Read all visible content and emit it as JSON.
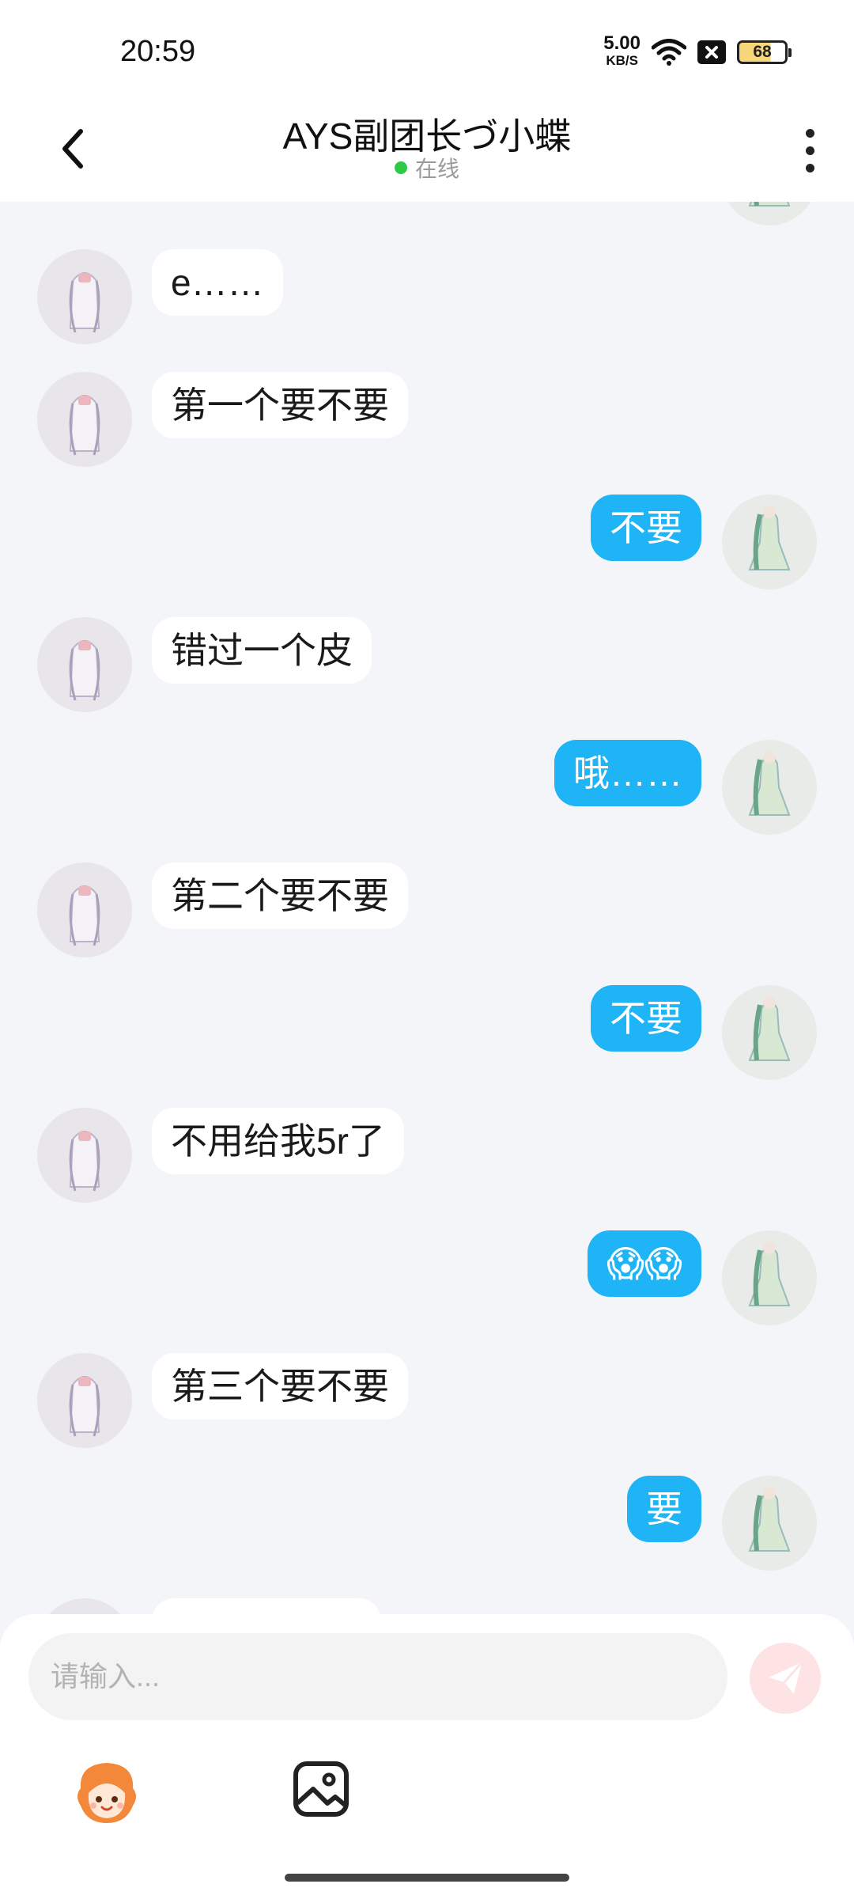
{
  "status_bar": {
    "time": "20:59",
    "net_speed": "5.00",
    "net_unit": "KB/S",
    "battery": "68"
  },
  "header": {
    "title": "AYS副团长づ小蝶",
    "status": "在线"
  },
  "messages": [
    {
      "side": "left",
      "text": "e……"
    },
    {
      "side": "left",
      "text": "第一个要不要"
    },
    {
      "side": "right",
      "text": "不要"
    },
    {
      "side": "left",
      "text": "错过一个皮"
    },
    {
      "side": "right",
      "text": "哦……"
    },
    {
      "side": "left",
      "text": "第二个要不要"
    },
    {
      "side": "right",
      "text": "不要"
    },
    {
      "side": "left",
      "text": "不用给我5r了"
    },
    {
      "side": "right",
      "text": "😱😱"
    },
    {
      "side": "left",
      "text": "第三个要不要"
    },
    {
      "side": "right",
      "text": "要"
    }
  ],
  "composer": {
    "placeholder": "请输入..."
  },
  "colors": {
    "bubble_self": "#1eb4f5",
    "bubble_other": "#ffffff",
    "online": "#2ec946",
    "send_button": "#fde3e4"
  },
  "icons": {
    "back": "chevron-left-icon",
    "more": "more-vertical-icon",
    "send": "paper-plane-icon",
    "emoji": "mascot-emoji-icon",
    "image": "image-icon"
  }
}
